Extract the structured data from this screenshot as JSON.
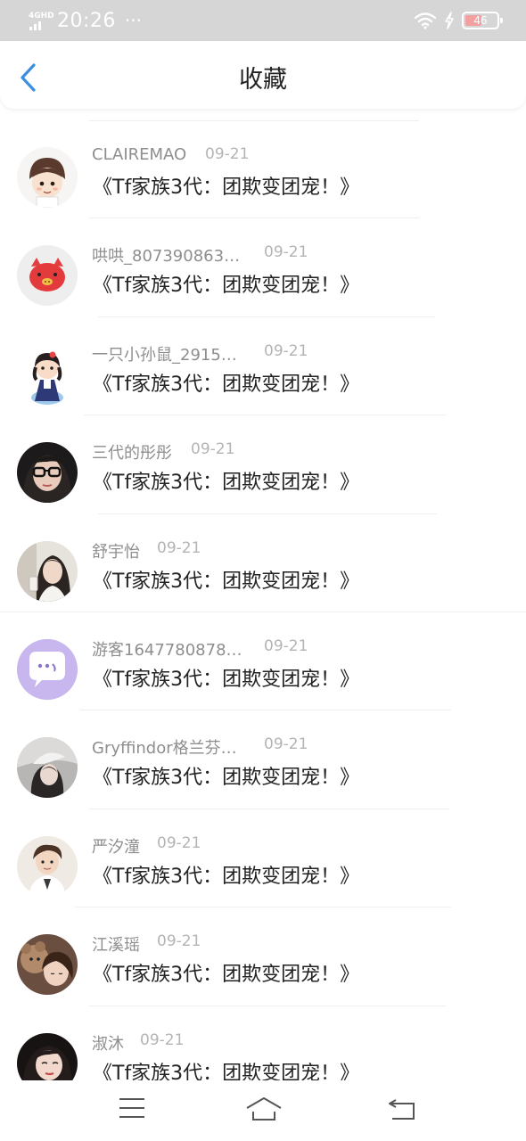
{
  "status_bar": {
    "network": "4GHD",
    "time": "20:26",
    "dots": "···",
    "battery": "46",
    "battery_color": "#f2a0a0"
  },
  "header": {
    "title": "收藏",
    "back_icon": "chevron-left-icon",
    "accent_color": "#3a8fe0"
  },
  "items": [
    {
      "user": "CLAIREMAO",
      "date": "09-21",
      "title": "《Tf家族3代：团欺变团宠！》",
      "avatar": "cartoon-boy-avatar"
    },
    {
      "user": "哄哄_807390863…",
      "date": "09-21",
      "title": "《Tf家族3代：团欺变团宠！》",
      "avatar": "red-pig-avatar"
    },
    {
      "user": "一只小孙鼠_2915…",
      "date": "09-21",
      "title": "《Tf家族3代：团欺变团宠！》",
      "avatar": "cartoon-girl-avatar"
    },
    {
      "user": "三代的彤彤",
      "date": "09-21",
      "title": "《Tf家族3代：团欺变团宠！》",
      "avatar": "girl-glasses-avatar"
    },
    {
      "user": "舒宇怡",
      "date": "09-21",
      "title": "《Tf家族3代：团欺变团宠！》",
      "avatar": "girl-photo-avatar"
    },
    {
      "user": "游客1647780878…",
      "date": "09-21",
      "title": "《Tf家族3代：团欺变团宠！》",
      "avatar": "chat-bubble-avatar"
    },
    {
      "user": "Gryffindor格兰芬…",
      "date": "09-21",
      "title": "《Tf家族3代：团欺变团宠！》",
      "avatar": "girl-hat-avatar"
    },
    {
      "user": "严汐潼",
      "date": "09-21",
      "title": "《Tf家族3代：团欺变团宠！》",
      "avatar": "boy-photo-avatar"
    },
    {
      "user": "江溪瑶",
      "date": "09-21",
      "title": "《Tf家族3代：团欺变团宠！》",
      "avatar": "girl-teddy-avatar"
    },
    {
      "user": "淑沐",
      "date": "09-21",
      "title": "《Tf家族3代：团欺变团宠！》",
      "avatar": "girl-dark-avatar"
    }
  ],
  "bottom_nav": {
    "menu_icon": "menu-icon",
    "home_icon": "home-icon",
    "back_icon": "return-icon"
  }
}
